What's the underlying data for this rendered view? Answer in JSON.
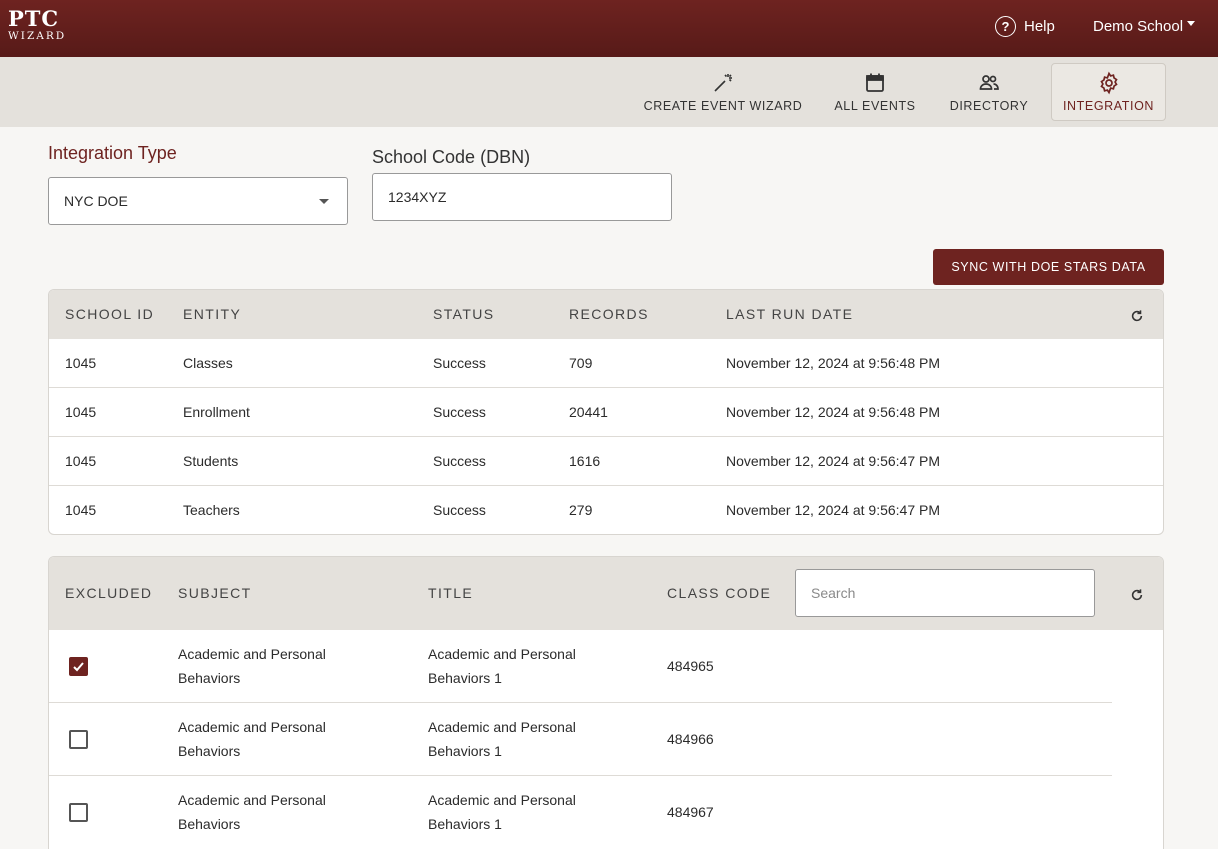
{
  "app": {
    "logo_top": "PTC",
    "logo_bottom": "WIZARD"
  },
  "topbar": {
    "help_label": "Help",
    "school_label": "Demo School"
  },
  "nav": {
    "items": [
      {
        "label": "CREATE EVENT WIZARD",
        "icon": "magic-wand-icon"
      },
      {
        "label": "ALL EVENTS",
        "icon": "calendar-icon"
      },
      {
        "label": "DIRECTORY",
        "icon": "people-icon"
      },
      {
        "label": "INTEGRATION",
        "icon": "gear-icon",
        "active": true
      }
    ]
  },
  "form": {
    "integration_type_label": "Integration Type",
    "integration_type_value": "NYC DOE",
    "school_code_label": "School Code (DBN)",
    "school_code_value": "1234XYZ",
    "sync_button": "SYNC WITH DOE STARS DATA"
  },
  "sync_table": {
    "headers": [
      "SCHOOL ID",
      "ENTITY",
      "STATUS",
      "RECORDS",
      "LAST RUN DATE"
    ],
    "rows": [
      {
        "school_id": "1045",
        "entity": "Classes",
        "status": "Success",
        "records": "709",
        "last_run": "November 12, 2024 at 9:56:48 PM"
      },
      {
        "school_id": "1045",
        "entity": "Enrollment",
        "status": "Success",
        "records": "20441",
        "last_run": "November 12, 2024 at 9:56:48 PM"
      },
      {
        "school_id": "1045",
        "entity": "Students",
        "status": "Success",
        "records": "1616",
        "last_run": "November 12, 2024 at 9:56:47 PM"
      },
      {
        "school_id": "1045",
        "entity": "Teachers",
        "status": "Success",
        "records": "279",
        "last_run": "November 12, 2024 at 9:56:47 PM"
      }
    ]
  },
  "class_table": {
    "headers": [
      "EXCLUDED",
      "SUBJECT",
      "TITLE",
      "CLASS CODE"
    ],
    "search_placeholder": "Search",
    "rows": [
      {
        "excluded": true,
        "subject_line1": "Academic and Personal",
        "subject_line2": "Behaviors",
        "title_line1": "Academic and Personal",
        "title_line2": "Behaviors 1",
        "class_code": "484965"
      },
      {
        "excluded": false,
        "subject_line1": "Academic and Personal",
        "subject_line2": "Behaviors",
        "title_line1": "Academic and Personal",
        "title_line2": "Behaviors 1",
        "class_code": "484966"
      },
      {
        "excluded": false,
        "subject_line1": "Academic and Personal",
        "subject_line2": "Behaviors",
        "title_line1": "Academic and Personal",
        "title_line2": "Behaviors 1",
        "class_code": "484967"
      }
    ]
  },
  "colors": {
    "brand": "#6e2320",
    "nav_bg": "#e4e1dc",
    "page_bg": "#f7f6f4"
  }
}
